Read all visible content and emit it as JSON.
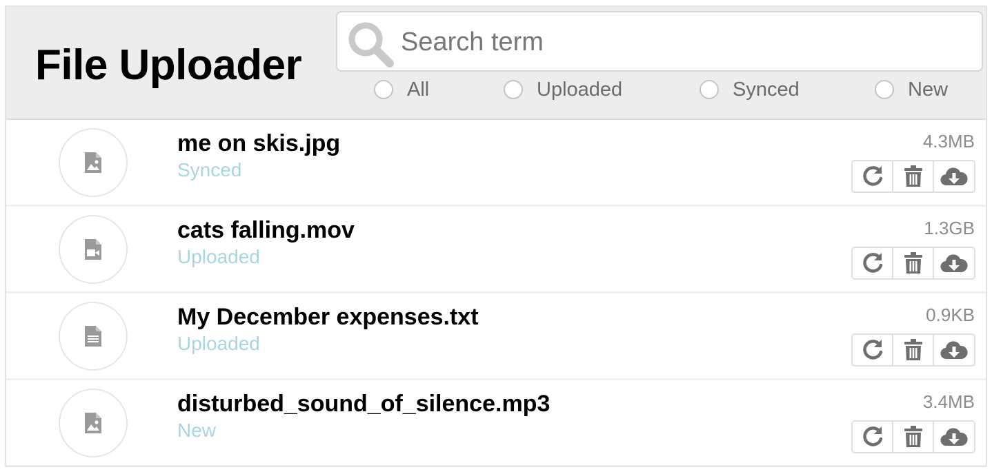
{
  "header": {
    "title": "File Uploader",
    "search": {
      "placeholder": "Search term",
      "value": "",
      "icon": "search-icon"
    },
    "filters": [
      {
        "label": "All",
        "selected": false
      },
      {
        "label": "Uploaded",
        "selected": false
      },
      {
        "label": "Synced",
        "selected": false
      },
      {
        "label": "New",
        "selected": false
      }
    ]
  },
  "files": [
    {
      "name": "me on skis.jpg",
      "status": "Synced",
      "size": "4.3MB",
      "icon": "image-file-icon"
    },
    {
      "name": "cats falling.mov",
      "status": "Uploaded",
      "size": "1.3GB",
      "icon": "video-file-icon"
    },
    {
      "name": "My December expenses.txt",
      "status": "Uploaded",
      "size": "0.9KB",
      "icon": "text-file-icon"
    },
    {
      "name": "disturbed_sound_of_silence.mp3",
      "status": "New",
      "size": "3.4MB",
      "icon": "image-file-icon"
    }
  ],
  "actions": [
    "refresh-icon",
    "trash-icon",
    "cloud-download-icon"
  ],
  "colors": {
    "header_bg": "#ededed",
    "status_text": "#a9d4e2",
    "icon_gray": "#6e6e6e",
    "thumb_icon": "#9a9a9a"
  }
}
